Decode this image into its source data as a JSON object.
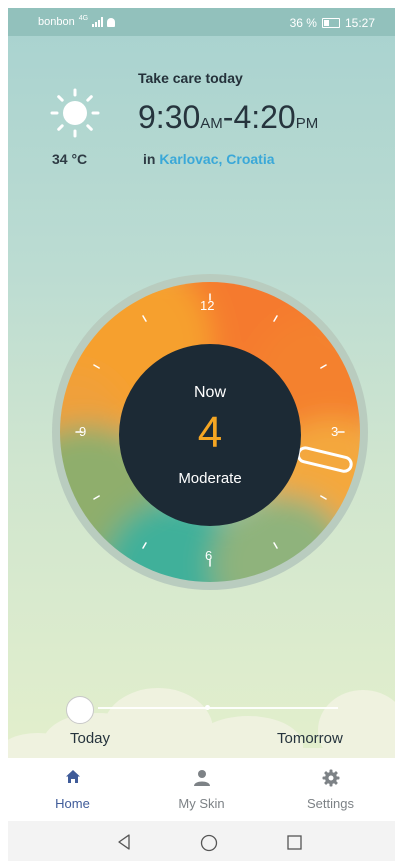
{
  "status_bar": {
    "carrier": "bonbon",
    "network": "4G",
    "battery": "36 %",
    "time": "15:27"
  },
  "weather": {
    "temperature": "34 °C",
    "icon": "sun-icon"
  },
  "header": {
    "title": "Take care today",
    "start_time": "9:30",
    "start_ampm": "AM",
    "separator": "-",
    "end_time": "4:20",
    "end_ampm": "PM",
    "location_prefix": "in",
    "location": "Karlovac, Croatia"
  },
  "uv_dial": {
    "now_label": "Now",
    "value": "4",
    "level": "Moderate",
    "hour_labels": {
      "h12": "12",
      "h3": "3",
      "h6": "6",
      "h9": "9"
    },
    "current_hour": 15.45
  },
  "day_slider": {
    "left_label": "Today",
    "right_label": "Tomorrow",
    "position": 0
  },
  "bottom_nav": {
    "items": [
      {
        "label": "Home",
        "icon": "home-icon",
        "active": true
      },
      {
        "label": "My Skin",
        "icon": "person-icon",
        "active": false
      },
      {
        "label": "Settings",
        "icon": "gear-icon",
        "active": false
      }
    ]
  },
  "system_nav": {
    "back": "back-icon",
    "home": "home-circle-icon",
    "recents": "recents-icon"
  },
  "colors": {
    "accent": "#3aa8d8",
    "uv_value": "#f5a623",
    "nav_active": "#3f5b99",
    "dial_center": "#1c2a35"
  }
}
